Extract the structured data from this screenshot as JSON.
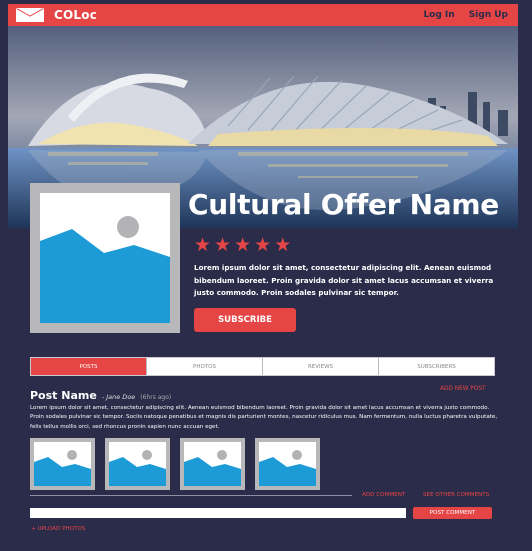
{
  "header": {
    "brand": "COLoc",
    "nav": [
      "Log In",
      "Sign Up"
    ],
    "accent": "#e64545",
    "background": "#2b2c4a"
  },
  "offer": {
    "title": "Cultural Offer Name",
    "rating": 5,
    "description": "Lorem ipsum dolor sit amet, consectetur adipiscing elit. Aenean euismod bibendum laoreet. Proin gravida dolor sit amet lacus accumsan et viverra justo commodo. Proin sodales pulvinar sic tempor.",
    "subscribe_label": "SUBSCRIBE"
  },
  "tabs": [
    {
      "label": "POSTS",
      "active": true
    },
    {
      "label": "PHOTOS",
      "active": false
    },
    {
      "label": "REVIEWS",
      "active": false
    },
    {
      "label": "SUBSCRIBERS",
      "active": false
    }
  ],
  "post": {
    "add_new_post": "ADD NEW POST",
    "name": "Post Name",
    "author": "- Jane Doe",
    "time": "(6hrs ago)",
    "body": "Lorem ipsum dolor sit amet, consectetur adipiscing elit. Aenean euismod bibendum laoreet. Proin gravida dolor sit amet lacus accumsan et viverra justo commodo. Proin sodales pulvinar sic tempor. Sociis natoque penatibus et magnis dis parturient montes, nascetur ridiculus mus. Nam fermentum, nulla luctus pharetra vulputate, felis tellus mollis orci, sed rhoncus pronin sapien nunc accuan eget.",
    "photo_count": 4,
    "add_comment": "ADD COMMENT",
    "see_comments": "SEE OTHER COMMENTS",
    "comment_placeholder": "",
    "post_comment": "POST COMMENT",
    "upload_photos": "+ UPLOAD PHOTOS"
  },
  "icons": {
    "logo": "envelope-icon",
    "placeholder": "image-placeholder-icon"
  }
}
